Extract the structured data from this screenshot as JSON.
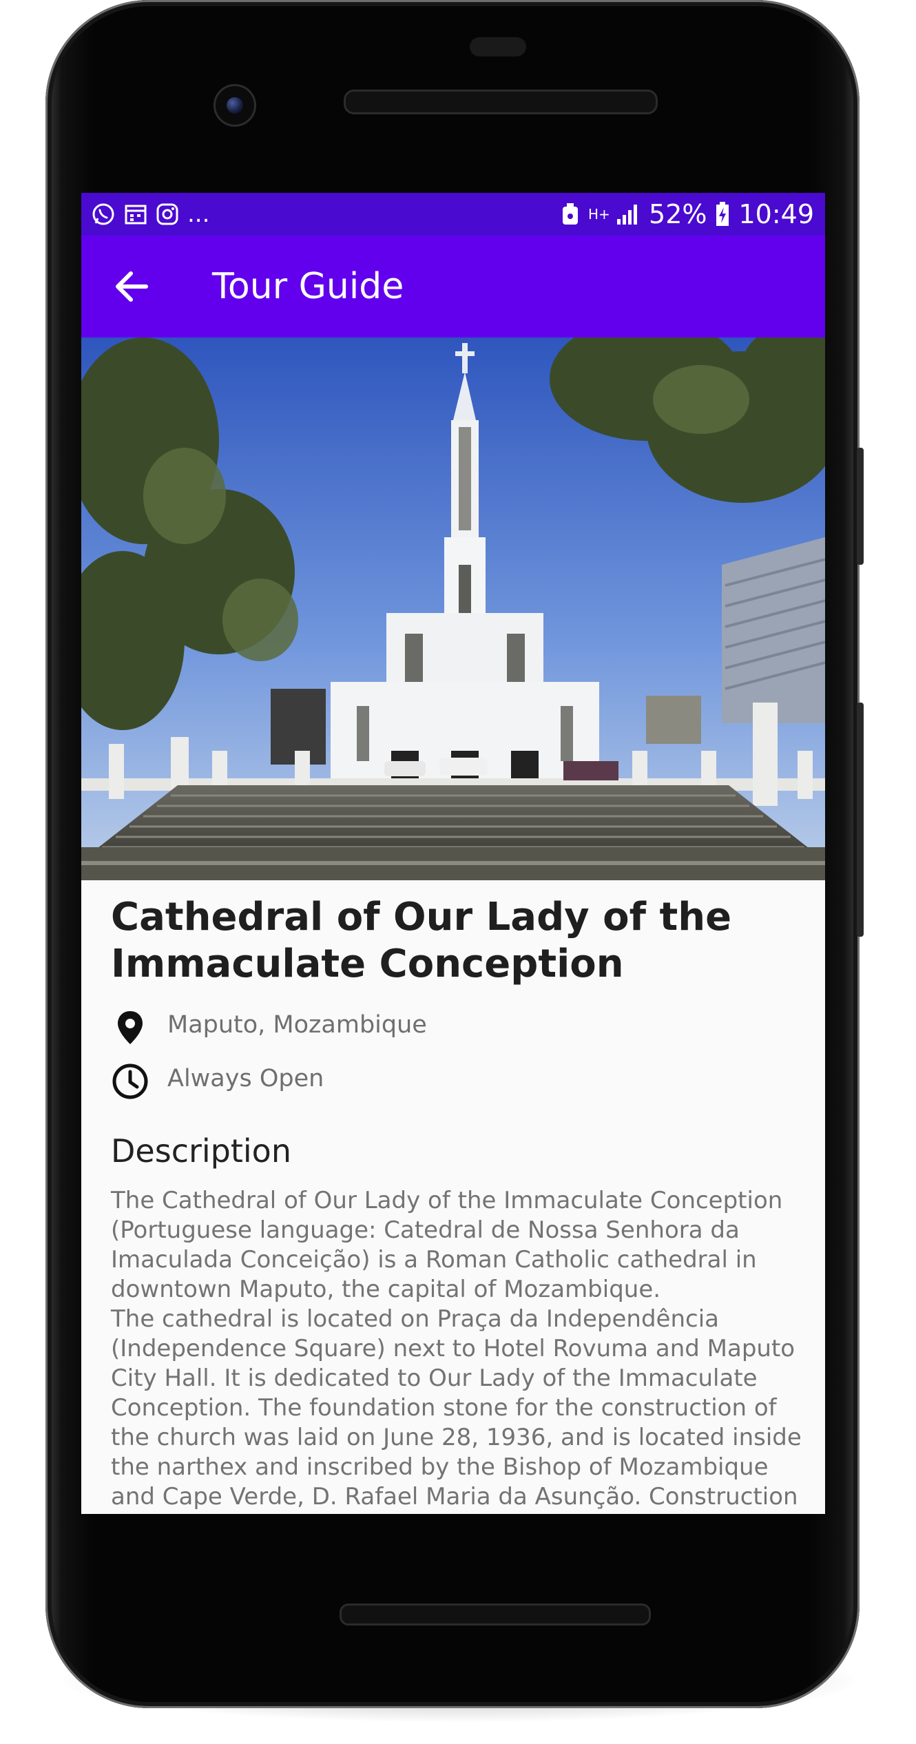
{
  "status_bar": {
    "battery": "52%",
    "time": "10:49",
    "notif_more": "...",
    "network": "H+"
  },
  "app_bar": {
    "title": "Tour Guide"
  },
  "place": {
    "title": "Cathedral of Our Lady of the Immaculate Conception",
    "location": "Maputo, Mozambique",
    "hours": "Always Open",
    "description_heading": "Description",
    "description": "The Cathedral of Our Lady of the Immaculate Conception (Portuguese language: Catedral de Nossa Senhora da Imaculada Conceição) is a Roman Catholic cathedral in downtown Maputo, the capital of Mozambique.\nThe cathedral is located on Praça da Independência (Independence Square) next to Hotel Rovuma and Maputo City Hall. It is dedicated to Our Lady of the Immaculate Conception. The foundation stone for the construction of the church was laid on June 28, 1936, and is located inside the narthex and inscribed by the Bishop of Mozambique and Cape Verde, D. Rafael Maria da Asunção. Construction on"
  },
  "colors": {
    "status_bar": "#4a0ad0",
    "app_bar": "#6200ee",
    "background": "#fafafa"
  },
  "icons": {
    "back": "arrow-back-icon",
    "location": "location-pin-icon",
    "hours": "clock-icon"
  }
}
